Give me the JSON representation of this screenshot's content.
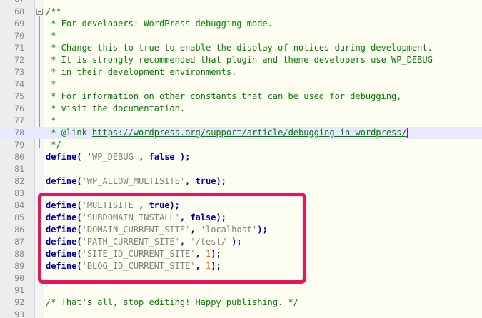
{
  "editor": {
    "highlight_color": "#e8145a",
    "lines": [
      {
        "num": "67",
        "parts": []
      },
      {
        "num": "68",
        "parts": [
          {
            "t": "/**",
            "c": "cm"
          }
        ]
      },
      {
        "num": "69",
        "parts": [
          {
            "t": " * For developers: WordPress debugging mode.",
            "c": "cm"
          }
        ]
      },
      {
        "num": "70",
        "parts": [
          {
            "t": " *",
            "c": "cm"
          }
        ]
      },
      {
        "num": "71",
        "parts": [
          {
            "t": " * Change this to true to enable the display of notices during development.",
            "c": "cm"
          }
        ]
      },
      {
        "num": "72",
        "parts": [
          {
            "t": " * It is strongly recommended that plugin and theme developers use WP_DEBUG",
            "c": "cm"
          }
        ]
      },
      {
        "num": "73",
        "parts": [
          {
            "t": " * in their development environments.",
            "c": "cm"
          }
        ]
      },
      {
        "num": "74",
        "parts": [
          {
            "t": " *",
            "c": "cm"
          }
        ]
      },
      {
        "num": "75",
        "parts": [
          {
            "t": " * For information on other constants that can be used for debugging,",
            "c": "cm"
          }
        ]
      },
      {
        "num": "76",
        "parts": [
          {
            "t": " * visit the documentation.",
            "c": "cm"
          }
        ]
      },
      {
        "num": "77",
        "parts": [
          {
            "t": " *",
            "c": "cm"
          }
        ]
      },
      {
        "num": "78",
        "current": true,
        "caret": true,
        "parts": [
          {
            "t": " * @link ",
            "c": "cm"
          },
          {
            "t": "https://wordpress.org/support/article/debugging-in-wordpress/",
            "c": "link"
          }
        ]
      },
      {
        "num": "79",
        "parts": [
          {
            "t": " */",
            "c": "cm"
          }
        ]
      },
      {
        "num": "80",
        "parts": [
          {
            "t": "define",
            "c": "kw"
          },
          {
            "t": "( ",
            "c": "op"
          },
          {
            "t": "'WP_DEBUG'",
            "c": "str"
          },
          {
            "t": ", ",
            "c": "op"
          },
          {
            "t": "false",
            "c": "kw"
          },
          {
            "t": " );",
            "c": "op"
          }
        ]
      },
      {
        "num": "81",
        "parts": []
      },
      {
        "num": "82",
        "parts": [
          {
            "t": "define",
            "c": "kw"
          },
          {
            "t": "(",
            "c": "op"
          },
          {
            "t": "'WP_ALLOW_MULTISITE'",
            "c": "str"
          },
          {
            "t": ", ",
            "c": "op"
          },
          {
            "t": "true",
            "c": "kw"
          },
          {
            "t": ");",
            "c": "op"
          }
        ]
      },
      {
        "num": "83",
        "parts": []
      },
      {
        "num": "84",
        "parts": [
          {
            "t": "define",
            "c": "kw"
          },
          {
            "t": "(",
            "c": "op"
          },
          {
            "t": "'MULTISITE'",
            "c": "str"
          },
          {
            "t": ", ",
            "c": "op"
          },
          {
            "t": "true",
            "c": "kw"
          },
          {
            "t": ");",
            "c": "op"
          }
        ]
      },
      {
        "num": "85",
        "parts": [
          {
            "t": "define",
            "c": "kw"
          },
          {
            "t": "(",
            "c": "op"
          },
          {
            "t": "'SUBDOMAIN_INSTALL'",
            "c": "str"
          },
          {
            "t": ", ",
            "c": "op"
          },
          {
            "t": "false",
            "c": "kw"
          },
          {
            "t": ");",
            "c": "op"
          }
        ]
      },
      {
        "num": "86",
        "parts": [
          {
            "t": "define",
            "c": "kw"
          },
          {
            "t": "(",
            "c": "op"
          },
          {
            "t": "'DOMAIN_CURRENT_SITE'",
            "c": "str"
          },
          {
            "t": ", ",
            "c": "op"
          },
          {
            "t": "'localhost'",
            "c": "str"
          },
          {
            "t": ");",
            "c": "op"
          }
        ]
      },
      {
        "num": "87",
        "parts": [
          {
            "t": "define",
            "c": "kw"
          },
          {
            "t": "(",
            "c": "op"
          },
          {
            "t": "'PATH_CURRENT_SITE'",
            "c": "str"
          },
          {
            "t": ", ",
            "c": "op"
          },
          {
            "t": "'/test/'",
            "c": "str"
          },
          {
            "t": ");",
            "c": "op"
          }
        ]
      },
      {
        "num": "88",
        "parts": [
          {
            "t": "define",
            "c": "kw"
          },
          {
            "t": "(",
            "c": "op"
          },
          {
            "t": "'SITE_ID_CURRENT_SITE'",
            "c": "str"
          },
          {
            "t": ", ",
            "c": "op"
          },
          {
            "t": "1",
            "c": "num"
          },
          {
            "t": ");",
            "c": "op"
          }
        ]
      },
      {
        "num": "89",
        "parts": [
          {
            "t": "define",
            "c": "kw"
          },
          {
            "t": "(",
            "c": "op"
          },
          {
            "t": "'BLOG_ID_CURRENT_SITE'",
            "c": "str"
          },
          {
            "t": ", ",
            "c": "op"
          },
          {
            "t": "1",
            "c": "num"
          },
          {
            "t": ");",
            "c": "op"
          }
        ]
      },
      {
        "num": "90",
        "parts": []
      },
      {
        "num": "91",
        "parts": []
      },
      {
        "num": "92",
        "parts": [
          {
            "t": "/* That's all, stop editing! Happy publishing. */",
            "c": "cm"
          }
        ]
      },
      {
        "num": "93",
        "parts": []
      }
    ]
  }
}
